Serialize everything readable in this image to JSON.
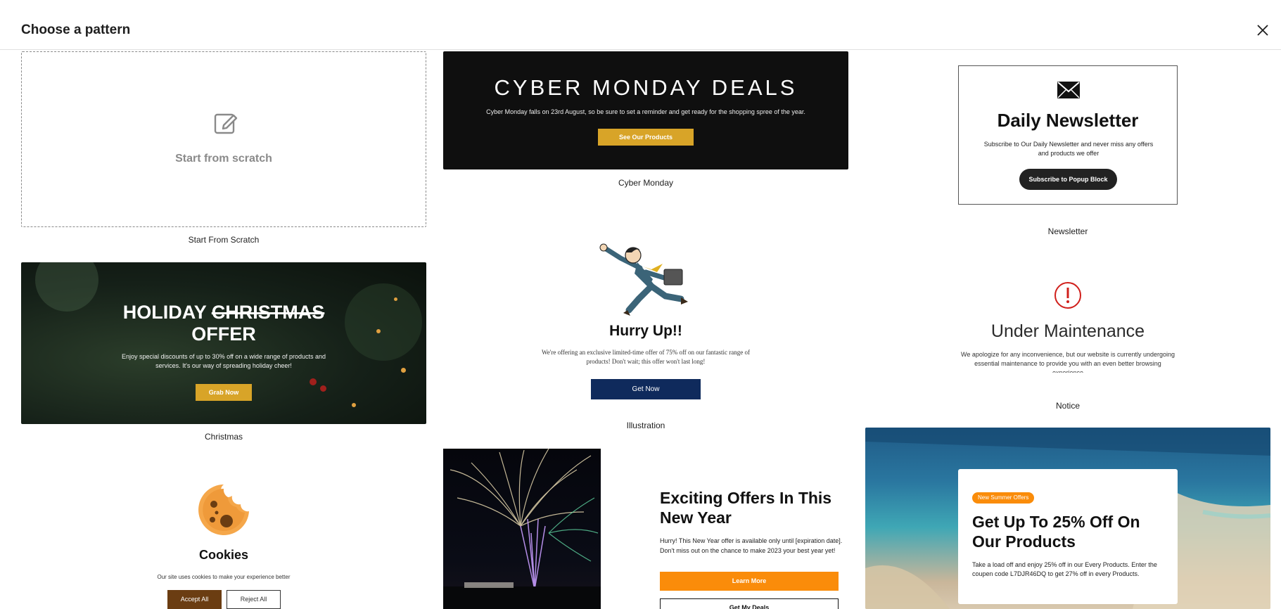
{
  "dialog": {
    "title": "Choose a pattern",
    "close_icon": "close-icon"
  },
  "patterns": {
    "scratch": {
      "label": "Start from scratch",
      "caption": "Start From Scratch",
      "icon": "edit-icon"
    },
    "cyber_monday": {
      "heading": "CYBER MONDAY DEALS",
      "text": "Cyber Monday falls on 23rd August, so be sure to set a reminder and get ready for the shopping spree of the year.",
      "button": "See Our Products",
      "caption": "Cyber Monday"
    },
    "newsletter": {
      "icon": "envelope-icon",
      "heading": "Daily Newsletter",
      "text": "Subscribe to Our Daily Newsletter and never miss any offers and products we offer",
      "button": "Subscribe to Popup Block",
      "caption": "Newsletter"
    },
    "christmas": {
      "heading_plain": "HOLIDAY ",
      "heading_struck": "CHRISTMAS",
      "heading_line2": "OFFER",
      "text": "Enjoy special discounts of up to 30% off on a wide range of products and services. It's our way of spreading holiday cheer!",
      "button": "Grab Now",
      "caption": "Christmas"
    },
    "illustration": {
      "heading": "Hurry Up!!",
      "text": "We're offering an exclusive limited-time offer of 75% off on our fantastic range of products! Don't wait; this offer won't last long!",
      "button": "Get Now",
      "caption": "Illustration"
    },
    "notice": {
      "icon": "exclamation-circle-icon",
      "heading": "Under Maintenance",
      "text": "We apologize for any inconvenience, but our website is currently undergoing essential maintenance to provide you with an even better browsing experience",
      "caption": "Notice"
    },
    "cookies": {
      "icon": "cookie-icon",
      "heading": "Cookies",
      "text": "Our site uses cookies to make your experience better",
      "accept": "Accept All",
      "reject": "Reject All"
    },
    "new_year": {
      "heading": "Exciting Offers In This New Year",
      "text": "Hurry! This New Year offer is available only until [expiration date]. Don't miss out on the chance to make 2023 your best year yet!",
      "primary": "Learn More",
      "secondary": "Get My Deals"
    },
    "summer": {
      "badge": "New Summer Offers",
      "heading": "Get Up To 25% Off On Our Products",
      "text": "Take a load off and enjoy 25% off in our Every Products. Enter the coupen code L7DJR46DQ to get 27% off in every Products."
    }
  },
  "colors": {
    "gold": "#d8a428",
    "navy": "#0f2a5c",
    "orange": "#fa8c0a",
    "brown": "#6b3d12",
    "red": "#d0201c"
  }
}
